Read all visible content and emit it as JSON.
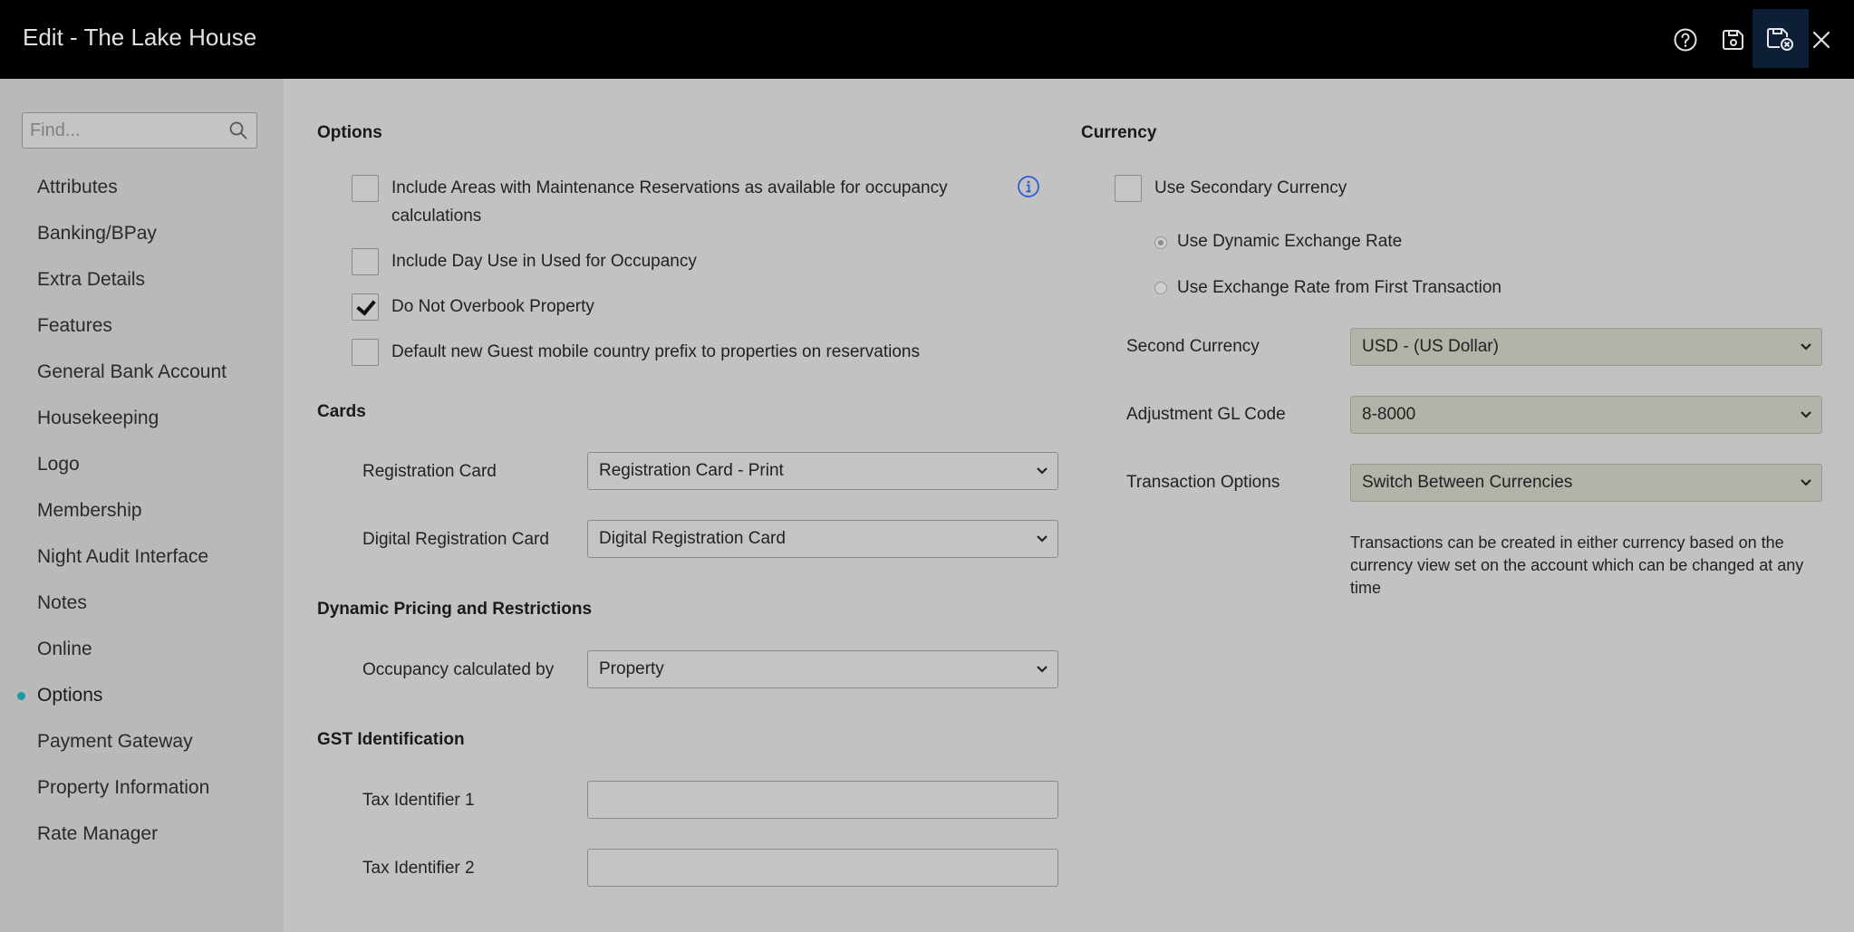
{
  "header": {
    "title": "Edit - The Lake House",
    "icons": [
      "help-icon",
      "save-icon",
      "save-and-exit-icon",
      "close-icon"
    ]
  },
  "sidebar": {
    "search_placeholder": "Find...",
    "items": [
      {
        "label": "Attributes"
      },
      {
        "label": "Banking/BPay"
      },
      {
        "label": "Extra Details"
      },
      {
        "label": "Features"
      },
      {
        "label": "General Bank Account"
      },
      {
        "label": "Housekeeping"
      },
      {
        "label": "Logo"
      },
      {
        "label": "Membership"
      },
      {
        "label": "Night Audit Interface"
      },
      {
        "label": "Notes"
      },
      {
        "label": "Online"
      },
      {
        "label": "Options",
        "active": true
      },
      {
        "label": "Payment Gateway"
      },
      {
        "label": "Property Information"
      },
      {
        "label": "Rate Manager"
      }
    ],
    "active_color": "#1c9aa6"
  },
  "options": {
    "heading": "Options",
    "checkboxes": [
      {
        "line1": "Include Areas with Maintenance Reservations as available for occupancy",
        "line2": "calculations",
        "checked": false
      },
      {
        "label": "Include Day Use in Used for Occupancy",
        "checked": false
      },
      {
        "label": "Do Not Overbook Property",
        "checked": true
      },
      {
        "label": "Default new Guest mobile country prefix to properties on reservations",
        "checked": false
      }
    ]
  },
  "cards": {
    "heading": "Cards",
    "registration_card_label": "Registration Card",
    "registration_card_value": "Registration Card - Print",
    "digital_card_label": "Digital Registration Card",
    "digital_card_value": "Digital Registration Card"
  },
  "dynamic_pricing": {
    "heading": "Dynamic Pricing and Restrictions",
    "occupancy_label": "Occupancy calculated by",
    "occupancy_value": "Property"
  },
  "gst": {
    "heading": "GST Identification",
    "tax1_label": "Tax Identifier 1",
    "tax1_value": "",
    "tax2_label": "Tax Identifier 2",
    "tax2_value": ""
  },
  "currency": {
    "heading": "Currency",
    "use_secondary_label": "Use Secondary Currency",
    "use_secondary_checked": false,
    "radio_dynamic_label": "Use Dynamic Exchange Rate",
    "radio_dynamic_selected": true,
    "radio_first_label": "Use Exchange Rate from First Transaction",
    "second_currency_label": "Second Currency",
    "second_currency_value": "USD - (US Dollar)",
    "adjustment_gl_label": "Adjustment GL Code",
    "adjustment_gl_value": "8-8000",
    "transaction_options_label": "Transaction Options",
    "transaction_options_value": "Switch Between Currencies",
    "helper_line1": "Transactions can be created in either currency based on the",
    "helper_line2": "currency view set on the account which can be changed at any",
    "helper_line3": "time"
  }
}
